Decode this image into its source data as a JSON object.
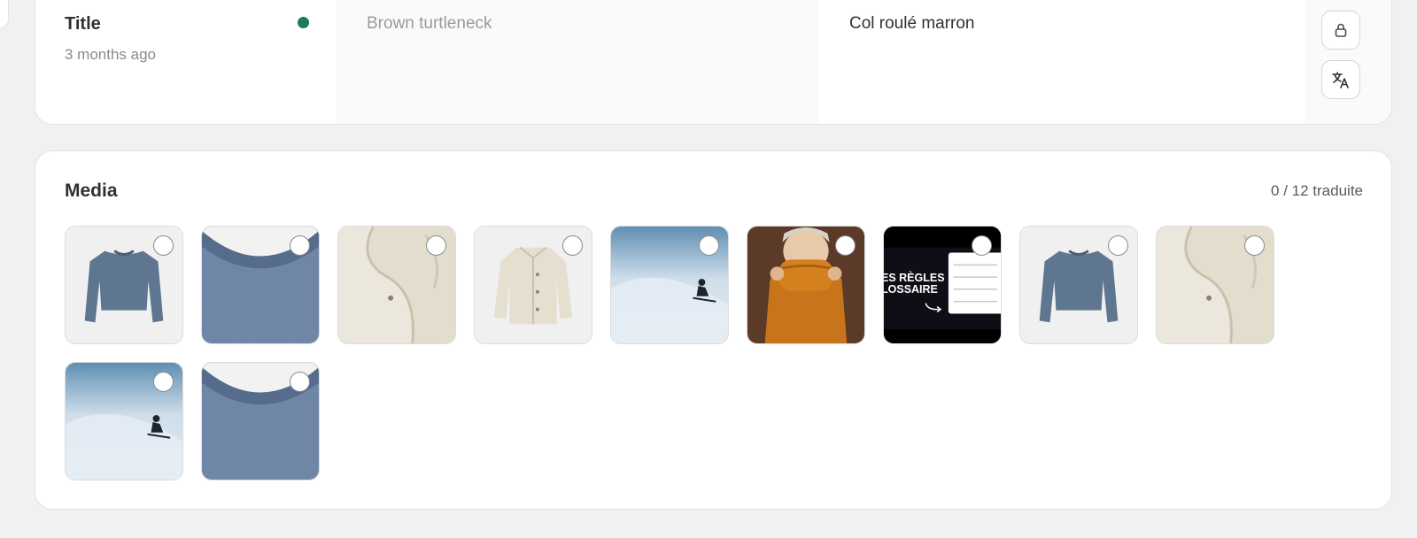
{
  "title_field": {
    "name": "Title",
    "updated": "3 months ago",
    "status_color": "#1c7d55",
    "source_text": "Brown turtleneck",
    "translated_text": "Col roulé marron"
  },
  "actions": {
    "lock_icon": "lock-icon",
    "translate_icon": "translate-icon"
  },
  "media": {
    "title": "Media",
    "count": "0 / 12 traduite",
    "items": [
      {
        "kind": "sweater",
        "selected": false
      },
      {
        "kind": "knit-closeup",
        "selected": false
      },
      {
        "kind": "puffer-closeup",
        "selected": false
      },
      {
        "kind": "puffer-jacket",
        "selected": false
      },
      {
        "kind": "snow-skier",
        "selected": false
      },
      {
        "kind": "orange-turtleneck",
        "selected": false
      },
      {
        "kind": "video-thumbnail",
        "selected": false,
        "caption_lines": [
          "ES RÈGLES",
          "LOSSAIRE"
        ]
      },
      {
        "kind": "sweater",
        "selected": false
      },
      {
        "kind": "puffer-closeup",
        "selected": false
      },
      {
        "kind": "snow-skier",
        "selected": false
      },
      {
        "kind": "knit-closeup",
        "selected": false
      }
    ]
  }
}
